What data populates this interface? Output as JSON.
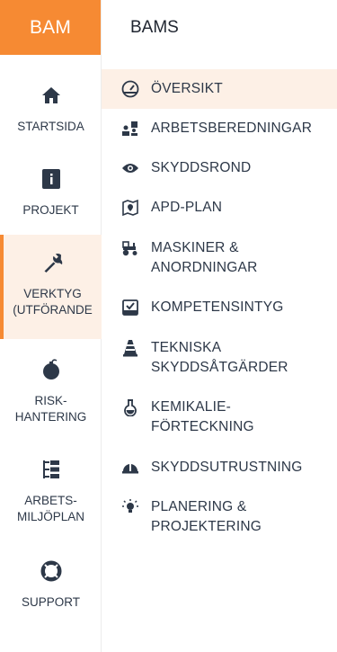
{
  "brand": {
    "logo_text": "BAM",
    "accent": "#f68a33",
    "active_bg": "#fdf0e6"
  },
  "header": {
    "title": "BAMS"
  },
  "rail": {
    "items": [
      {
        "label": "STARTSIDA",
        "icon": "home-icon"
      },
      {
        "label": "PROJEKT",
        "icon": "info-icon"
      },
      {
        "label": "VERKTYG\n(UTFÖRANDE",
        "icon": "wrench-icon",
        "active": true
      },
      {
        "label": "RISK-\nHANTERING",
        "icon": "bomb-icon"
      },
      {
        "label": "ARBETS-\nMILJÖPLAN",
        "icon": "list-tree-icon"
      },
      {
        "label": "SUPPORT",
        "icon": "lifebuoy-icon"
      }
    ]
  },
  "menu": {
    "items": [
      {
        "label": "ÖVERSIKT",
        "icon": "gauge-icon",
        "active": true
      },
      {
        "label": "ARBETSBEREDNINGAR",
        "icon": "people-chart-icon"
      },
      {
        "label": "SKYDDSROND",
        "icon": "eye-icon"
      },
      {
        "label": "APD-PLAN",
        "icon": "map-pin-icon"
      },
      {
        "label": "MASKINER &\nANORDNINGAR",
        "icon": "tractor-icon"
      },
      {
        "label": "KOMPETENSINTYG",
        "icon": "certificate-icon"
      },
      {
        "label": "TEKNISKA\nSKYDDSÅTGÄRDER",
        "icon": "cone-icon"
      },
      {
        "label": "KEMIKALIE-\nFÖRTECKNING",
        "icon": "flask-icon"
      },
      {
        "label": "SKYDDSUTRUSTNING",
        "icon": "helmet-icon"
      },
      {
        "label": "PLANERING &\nPROJEKTERING",
        "icon": "lightbulb-icon"
      }
    ]
  }
}
